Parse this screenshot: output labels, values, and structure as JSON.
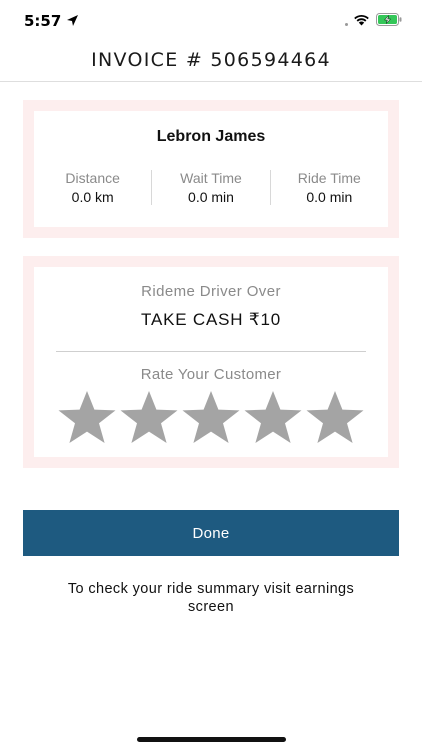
{
  "status_bar": {
    "time": "5:57",
    "icons": [
      "location-arrow-icon",
      "wifi-icon",
      "battery-charging-icon"
    ],
    "battery_color": "#34c759"
  },
  "header": {
    "title": "INVOICE # 506594464"
  },
  "ride_card": {
    "rider_name": "Lebron James",
    "stats": [
      {
        "label": "Distance",
        "value": "0.0 km"
      },
      {
        "label": "Wait Time",
        "value": "0.0 min"
      },
      {
        "label": "Ride Time",
        "value": "0.0 min"
      }
    ]
  },
  "payment_card": {
    "over_label": "Rideme Driver Over",
    "cash_label": "TAKE CASH ₹10",
    "rate_label": "Rate Your Customer",
    "rating": {
      "value": 0,
      "max": 5
    },
    "star_color": "#a4a4a4"
  },
  "done_button": {
    "label": "Done",
    "color": "#1e5a80"
  },
  "info_text": "To check your ride summary visit earnings screen",
  "colors": {
    "card_border": "#fdeeee",
    "muted_text": "#8a8a8a"
  }
}
